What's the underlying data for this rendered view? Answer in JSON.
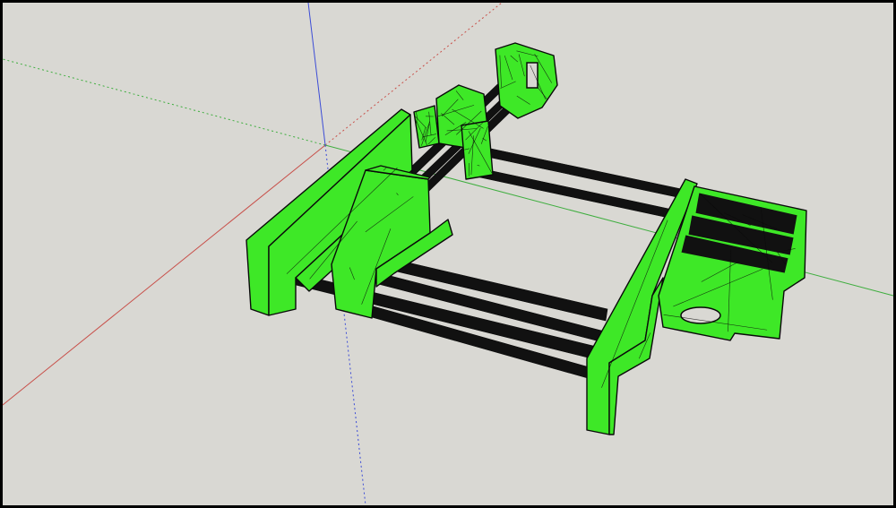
{
  "viewport": {
    "background_color": "#d9d8d3",
    "frame_color": "#000000"
  },
  "axes": {
    "red_axis_color": "#c8504a",
    "green_axis_color": "#3fae3f",
    "blue_axis_color": "#3b4bd6"
  },
  "model": {
    "fill_color": "#3ee827",
    "edge_color": "#0a0a0a",
    "rod_color": "#111111"
  }
}
